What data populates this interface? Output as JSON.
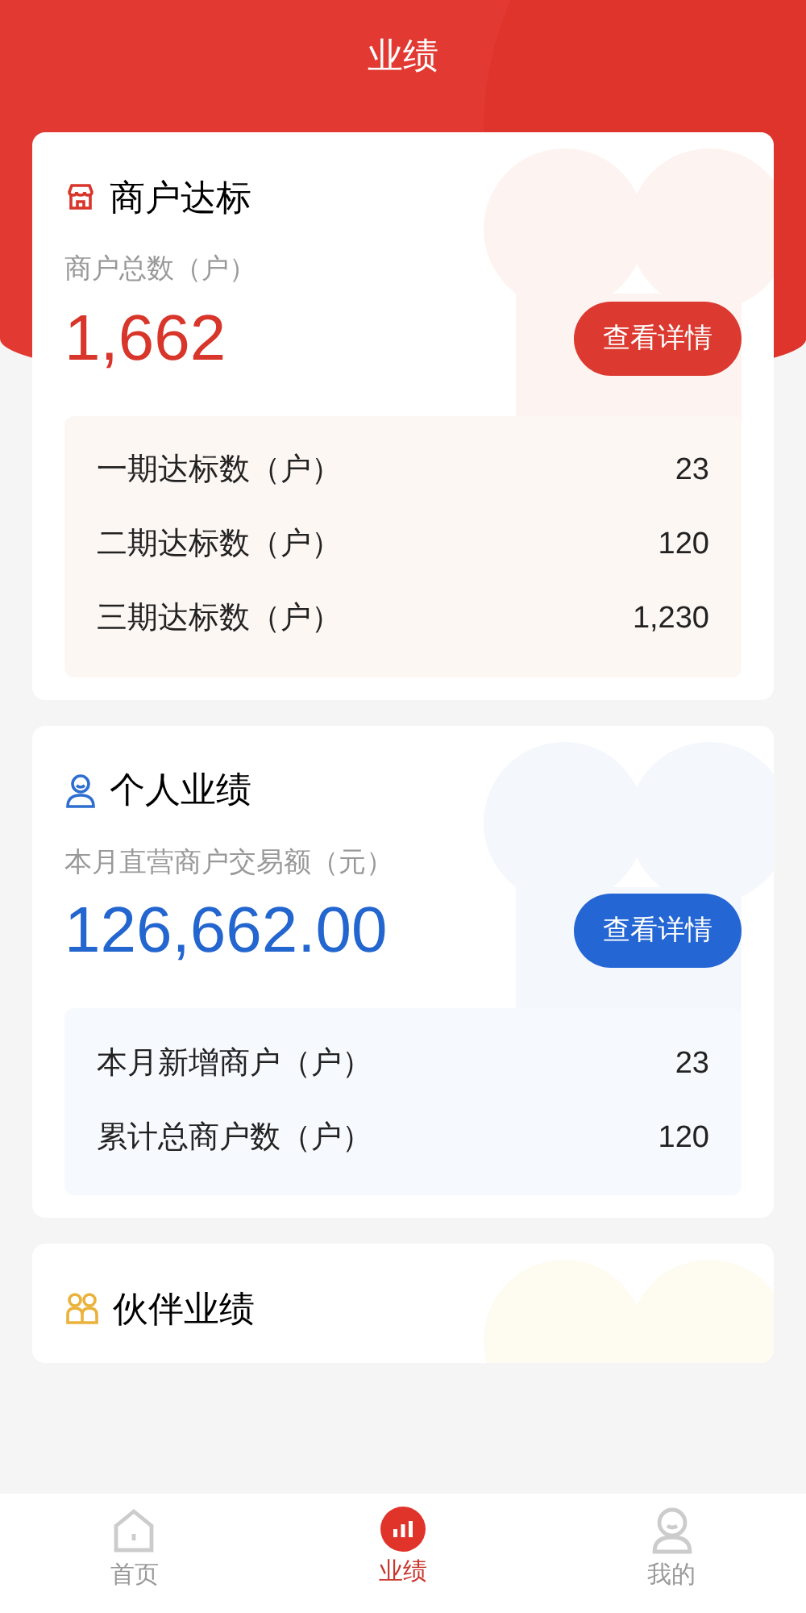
{
  "header": {
    "title": "业绩"
  },
  "cards": [
    {
      "kind": "store",
      "title": "商户达标",
      "label": "商户总数（户）",
      "value": "1,662",
      "button": "查看详情",
      "stats": [
        {
          "label": "一期达标数（户）",
          "value": "23"
        },
        {
          "label": "二期达标数（户）",
          "value": "120"
        },
        {
          "label": "三期达标数（户）",
          "value": "1,230"
        }
      ]
    },
    {
      "kind": "person",
      "title": "个人业绩",
      "label": "本月直营商户交易额（元）",
      "value": "126,662.00",
      "button": "查看详情",
      "stats": [
        {
          "label": "本月新增商户（户）",
          "value": "23"
        },
        {
          "label": "累计总商户数（户）",
          "value": "120"
        }
      ]
    },
    {
      "kind": "partners",
      "title": "伙伴业绩"
    }
  ],
  "tabs": [
    {
      "kind": "home",
      "label": "首页",
      "selected": false
    },
    {
      "kind": "chart",
      "label": "业绩",
      "selected": true
    },
    {
      "kind": "user",
      "label": "我的",
      "selected": false
    }
  ]
}
